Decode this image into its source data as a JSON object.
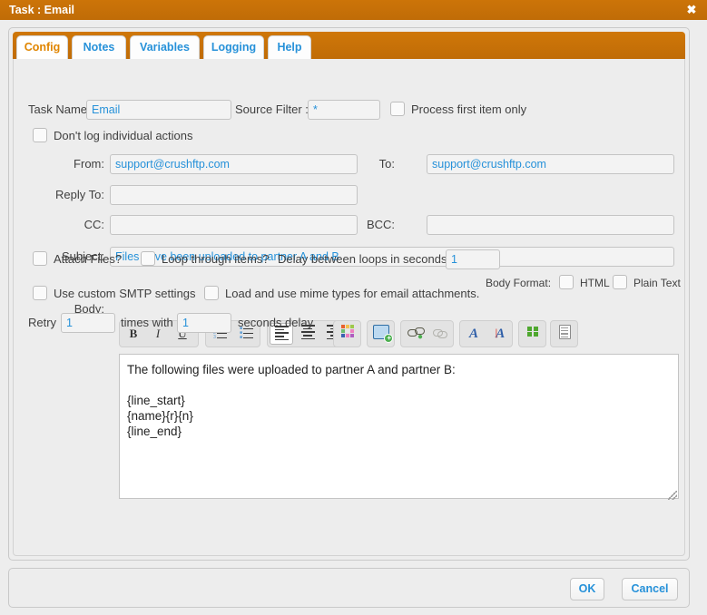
{
  "window": {
    "title": "Task : Email",
    "close_icon": "close-icon",
    "accent_color": "#c8720a",
    "link_color": "#2691d9"
  },
  "tabs": [
    {
      "label": "Config",
      "active": true
    },
    {
      "label": "Notes",
      "active": false
    },
    {
      "label": "Variables",
      "active": false
    },
    {
      "label": "Logging",
      "active": false
    },
    {
      "label": "Help",
      "active": false
    }
  ],
  "form": {
    "task_name_label": "Task Name:",
    "task_name_value": "Email",
    "source_filter_label": "Source Filter :",
    "source_filter_value": "*",
    "process_first_item_label": "Process first item only",
    "process_first_item_checked": false,
    "dont_log_label": "Don't log individual actions",
    "dont_log_checked": false,
    "from_label": "From:",
    "from_value": "support@crushftp.com",
    "to_label": "To:",
    "to_value": "support@crushftp.com",
    "reply_to_label": "Reply To:",
    "reply_to_value": "",
    "cc_label": "CC:",
    "cc_value": "",
    "bcc_label": "BCC:",
    "bcc_value": "",
    "subject_label": "Subject:",
    "subject_value": "Files have been uploaded to partner A and B",
    "body_format_label": "Body Format:",
    "html_label": "HTML",
    "html_checked": false,
    "plain_text_label": "Plain Text",
    "plain_text_checked": false,
    "body_label": "Body:",
    "body_value": "The following files were uploaded to partner A and partner B:\n\n{line_start}\n{name}{r}{n}\n{line_end}"
  },
  "editor_toolbar": [
    {
      "name": "bold-icon",
      "glyph": "B"
    },
    {
      "name": "italic-icon",
      "glyph": "I"
    },
    {
      "name": "underline-icon",
      "glyph": "U"
    },
    {
      "name": "ordered-list-icon",
      "glyph": ""
    },
    {
      "name": "unordered-list-icon",
      "glyph": ""
    },
    {
      "name": "align-left-icon",
      "glyph": "",
      "pressed": true
    },
    {
      "name": "align-center-icon",
      "glyph": ""
    },
    {
      "name": "align-right-icon",
      "glyph": ""
    },
    {
      "name": "color-palette-icon",
      "glyph": ""
    },
    {
      "name": "insert-image-icon",
      "glyph": ""
    },
    {
      "name": "insert-link-icon",
      "glyph": ""
    },
    {
      "name": "remove-link-icon",
      "glyph": "",
      "disabled": true
    },
    {
      "name": "font-color-icon",
      "glyph": "A"
    },
    {
      "name": "background-color-icon",
      "glyph": "A"
    },
    {
      "name": "insert-variable-icon",
      "glyph": ""
    },
    {
      "name": "source-view-icon",
      "glyph": ""
    }
  ],
  "options": {
    "attach_files_label": "Attach Files?",
    "attach_files_checked": false,
    "loop_through_items_label": "Loop through items?",
    "loop_through_items_checked": false,
    "delay_label": "Delay between loops in seconds:",
    "delay_value": "1",
    "custom_smtp_label": "Use custom SMTP settings",
    "custom_smtp_checked": false,
    "mime_types_label": "Load and use mime types for email attachments.",
    "mime_types_checked": false,
    "retry_prefix": "Retry",
    "retry_times_value": "1",
    "retry_mid": "times with",
    "retry_delay_value": "1",
    "retry_suffix": "seconds delay."
  },
  "footer": {
    "ok_label": "OK",
    "cancel_label": "Cancel"
  }
}
